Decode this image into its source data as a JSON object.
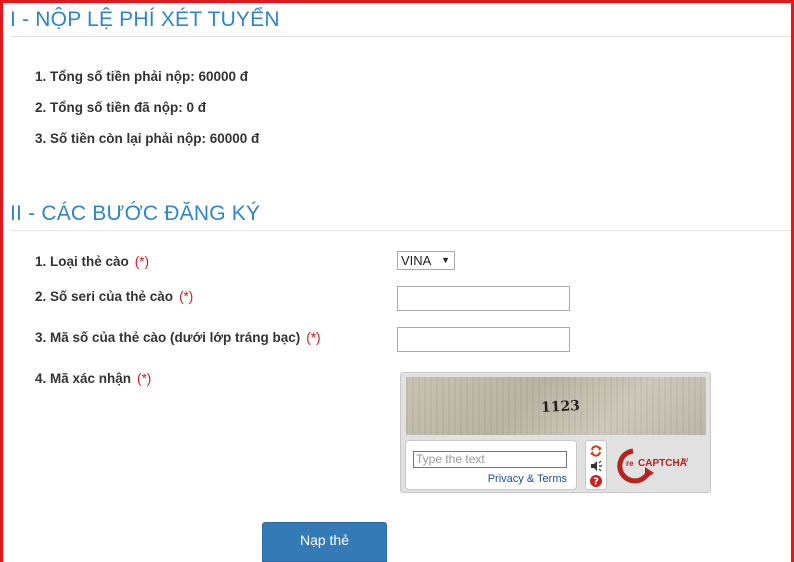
{
  "section1": {
    "title": "I - NỘP LỆ PHÍ XÉT TUYỂN",
    "lines": [
      "1. Tổng số tiền phải nộp: 60000 đ",
      "2. Tổng số tiền đã nộp: 0 đ",
      "3. Số tiền còn lại phải nộp: 60000 đ"
    ]
  },
  "section2": {
    "title": "II - CÁC BƯỚC ĐĂNG KÝ",
    "required_mark": "(*)",
    "card_type": {
      "label": "1. Loại thẻ cào",
      "selected": "VINA"
    },
    "serial": {
      "label": "2. Số seri của thẻ cào",
      "value": ""
    },
    "card_code": {
      "label": "3. Mã số của thẻ cào (dưới lớp tráng bạc)",
      "value": ""
    },
    "captcha_label": "4. Mã xác nhận"
  },
  "captcha": {
    "challenge_text": "1123",
    "placeholder": "Type the text",
    "privacy": "Privacy",
    "amp": "&",
    "terms": "Terms",
    "logo_prefix": "re",
    "logo_text": "CAPTCHA",
    "logo_tm": "TM",
    "icons": [
      "refresh-icon",
      "audio-icon",
      "help-icon"
    ]
  },
  "submit_label": "Nạp thẻ",
  "colors": {
    "accent": "#2e86c7",
    "required": "#d9171e",
    "button": "#337ab7",
    "frame": "#e8151b"
  }
}
